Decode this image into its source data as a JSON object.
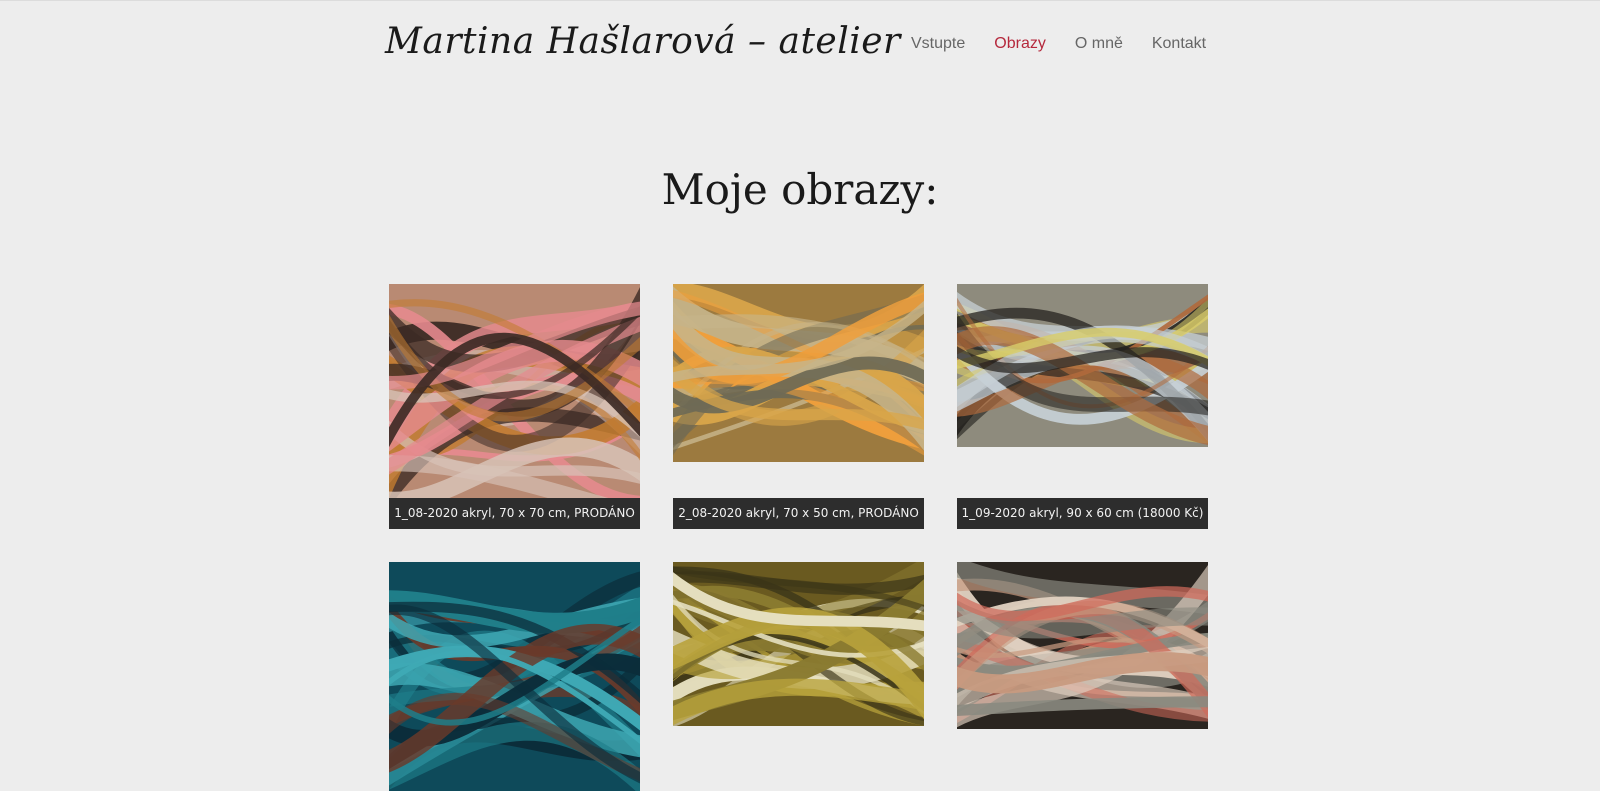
{
  "site": {
    "title": "Martina Hašlarová – atelier"
  },
  "nav": {
    "items": [
      {
        "label": "Vstupte"
      },
      {
        "label": "Obrazy"
      },
      {
        "label": "O mně"
      },
      {
        "label": "Kontakt"
      }
    ],
    "active": "Obrazy",
    "active_color": "#b5283c"
  },
  "page": {
    "heading": "Moje obrazy:"
  },
  "gallery": {
    "items": [
      {
        "caption": "1_08-2020 akryl, 70 x 70 cm, PRODÁNO",
        "palette": [
          "#b98a73",
          "#e58a8e",
          "#3b2a24",
          "#d8c3b8",
          "#c27b2f"
        ]
      },
      {
        "caption": "2_08-2020 akryl, 70 x 50 cm, PRODÁNO",
        "palette": [
          "#9c7a3f",
          "#d9a54a",
          "#c7b48a",
          "#6e6a55",
          "#ef9f3c"
        ]
      },
      {
        "caption": "1_09-2020 akryl, 90 x 60 cm (18000 Kč)",
        "palette": [
          "#8e8b7d",
          "#d8cc6a",
          "#262420",
          "#c7d0d6",
          "#b06a3c"
        ]
      },
      {
        "caption": "",
        "palette": [
          "#0e4a5a",
          "#1f7e8a",
          "#0b2d3a",
          "#6a3a2a",
          "#3fa9b5"
        ]
      },
      {
        "caption": "",
        "palette": [
          "#6a5a20",
          "#b8a23c",
          "#e6e0c0",
          "#3a3418",
          "#8a7a30"
        ]
      },
      {
        "caption": "",
        "palette": [
          "#2a2520",
          "#c89a80",
          "#8a8a80",
          "#d06a5a",
          "#e0d0c0"
        ]
      }
    ]
  }
}
